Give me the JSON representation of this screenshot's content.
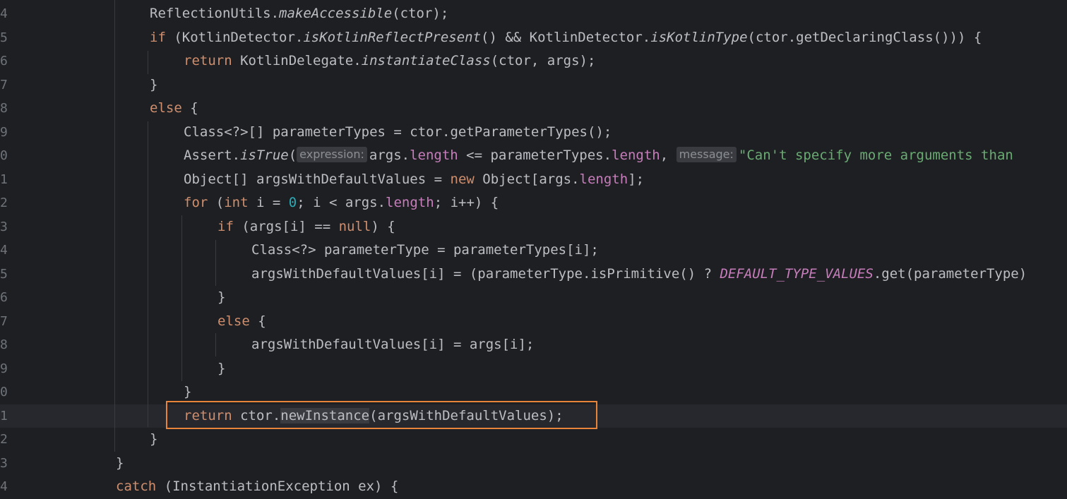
{
  "editor": {
    "lines": [
      {
        "n": "4",
        "indent": 4,
        "parts": [
          [
            "t",
            "ReflectionUtils."
          ],
          [
            "it",
            "makeAccessible"
          ],
          [
            "t",
            "(ctor);"
          ]
        ]
      },
      {
        "n": "5",
        "indent": 4,
        "parts": [
          [
            "kw",
            "if "
          ],
          [
            "t",
            "(KotlinDetector."
          ],
          [
            "it",
            "isKotlinReflectPresent"
          ],
          [
            "t",
            "() && KotlinDetector."
          ],
          [
            "it",
            "isKotlinType"
          ],
          [
            "t",
            "(ctor.getDeclaringClass())) {"
          ]
        ]
      },
      {
        "n": "6",
        "indent": 5,
        "parts": [
          [
            "kw",
            "return "
          ],
          [
            "t",
            "KotlinDelegate."
          ],
          [
            "it",
            "instantiateClass"
          ],
          [
            "t",
            "(ctor, args);"
          ]
        ]
      },
      {
        "n": "7",
        "indent": 4,
        "parts": [
          [
            "t",
            "}"
          ]
        ]
      },
      {
        "n": "8",
        "indent": 4,
        "parts": [
          [
            "kw",
            "else "
          ],
          [
            "t",
            "{"
          ]
        ]
      },
      {
        "n": "9",
        "indent": 5,
        "parts": [
          [
            "t",
            "Class<?>[] parameterTypes = ctor.getParameterTypes();"
          ]
        ]
      },
      {
        "n": "0",
        "indent": 5,
        "parts": [
          [
            "t",
            "Assert."
          ],
          [
            "it",
            "isTrue"
          ],
          [
            "t",
            "("
          ],
          [
            "hint",
            "expression:"
          ],
          [
            "t",
            "args."
          ],
          [
            "field",
            "length"
          ],
          [
            "t",
            " <= parameterTypes."
          ],
          [
            "field",
            "length"
          ],
          [
            "t",
            ", "
          ],
          [
            "hint",
            "message:"
          ],
          [
            "str",
            "\"Can't specify more arguments than"
          ]
        ]
      },
      {
        "n": "1",
        "indent": 5,
        "parts": [
          [
            "t",
            "Object[] argsWithDefaultValues = "
          ],
          [
            "kw",
            "new "
          ],
          [
            "t",
            "Object[args."
          ],
          [
            "field",
            "length"
          ],
          [
            "t",
            "];"
          ]
        ]
      },
      {
        "n": "2",
        "indent": 5,
        "parts": [
          [
            "kw",
            "for "
          ],
          [
            "t",
            "("
          ],
          [
            "kw",
            "int "
          ],
          [
            "t",
            "i = "
          ],
          [
            "num",
            "0"
          ],
          [
            "t",
            "; i < args."
          ],
          [
            "field",
            "length"
          ],
          [
            "t",
            "; i++) {"
          ]
        ]
      },
      {
        "n": "3",
        "indent": 6,
        "parts": [
          [
            "kw",
            "if "
          ],
          [
            "t",
            "(args[i] == "
          ],
          [
            "kw",
            "null"
          ],
          [
            "t",
            ") {"
          ]
        ]
      },
      {
        "n": "4",
        "indent": 7,
        "parts": [
          [
            "t",
            "Class<?> parameterType = parameterTypes[i];"
          ]
        ]
      },
      {
        "n": "5",
        "indent": 7,
        "parts": [
          [
            "t",
            "argsWithDefaultValues[i] = (parameterType.isPrimitive() ? "
          ],
          [
            "const",
            "DEFAULT_TYPE_VALUES"
          ],
          [
            "t",
            ".get(parameterType)"
          ]
        ]
      },
      {
        "n": "6",
        "indent": 6,
        "parts": [
          [
            "t",
            "}"
          ]
        ]
      },
      {
        "n": "7",
        "indent": 6,
        "parts": [
          [
            "kw",
            "else "
          ],
          [
            "t",
            "{"
          ]
        ]
      },
      {
        "n": "8",
        "indent": 7,
        "parts": [
          [
            "t",
            "argsWithDefaultValues[i] = args[i];"
          ]
        ]
      },
      {
        "n": "9",
        "indent": 6,
        "parts": [
          [
            "t",
            "}"
          ]
        ]
      },
      {
        "n": "0",
        "indent": 5,
        "parts": [
          [
            "t",
            "}"
          ]
        ]
      },
      {
        "n": "1",
        "indent": 5,
        "current": true,
        "parts": [
          [
            "kw",
            "return "
          ],
          [
            "t",
            "ctor."
          ],
          [
            "hl",
            "newInstance"
          ],
          [
            "t",
            "(argsWithDefaultValues);"
          ]
        ]
      },
      {
        "n": "2",
        "indent": 4,
        "parts": [
          [
            "t",
            "}"
          ]
        ]
      },
      {
        "n": "3",
        "indent": 3,
        "parts": [
          [
            "t",
            "}"
          ]
        ]
      },
      {
        "n": "4",
        "indent": 3,
        "parts": [
          [
            "kw",
            "catch "
          ],
          [
            "t",
            "(InstantiationException ex) {"
          ]
        ]
      }
    ]
  },
  "colors": {
    "background": "#1e1f22",
    "keyword": "#cf8e6d",
    "number": "#2aacb8",
    "string": "#6aab73",
    "field": "#c77dbb",
    "highlight_box": "#e8833a"
  }
}
